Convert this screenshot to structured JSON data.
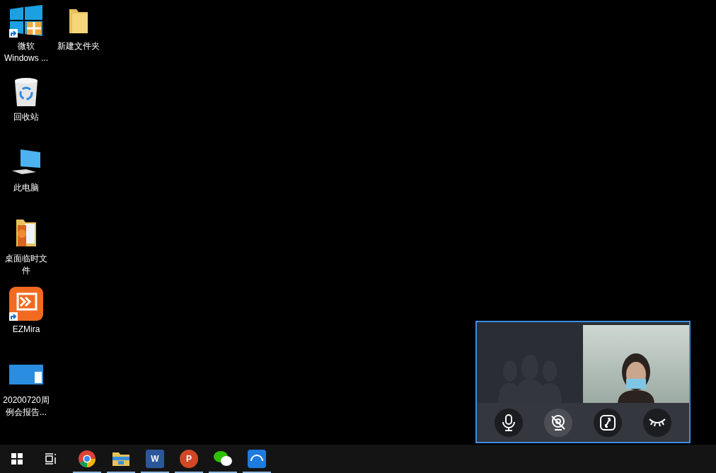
{
  "desktop_icons": [
    {
      "kind": "windows",
      "label": "微软 Windows ...",
      "shortcut": true
    },
    {
      "kind": "folder",
      "label": "新建文件夹",
      "shortcut": false
    },
    {
      "kind": "recycle",
      "label": "回收站",
      "shortcut": false
    },
    {
      "kind": "computer",
      "label": "此电脑",
      "shortcut": false
    },
    {
      "kind": "docfolder",
      "label": "桌面临时文件",
      "shortcut": false
    },
    {
      "kind": "ezmira",
      "label": "EZMira",
      "shortcut": true
    },
    {
      "kind": "slide",
      "label": "20200720周例会报告...",
      "shortcut": false
    }
  ],
  "call_window": {
    "controls": [
      {
        "kind": "mic",
        "off": false
      },
      {
        "kind": "camera",
        "off": true
      },
      {
        "kind": "switch",
        "off": false
      },
      {
        "kind": "eye",
        "off": false
      }
    ]
  },
  "taskbar": {
    "apps": [
      {
        "kind": "chrome",
        "running": true
      },
      {
        "kind": "explorer",
        "running": true
      },
      {
        "kind": "word",
        "letter": "W",
        "running": true
      },
      {
        "kind": "powerpoint",
        "letter": "P",
        "running": true
      },
      {
        "kind": "wechat",
        "running": true
      },
      {
        "kind": "ezmira",
        "running": true
      }
    ]
  }
}
